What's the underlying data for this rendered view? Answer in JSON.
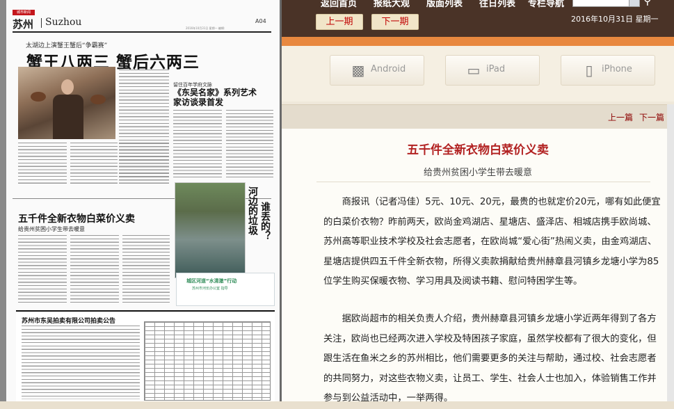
{
  "newspaper": {
    "section_logo": "城市新闻",
    "city": "苏州",
    "city_en": "Suzhou",
    "page": "A04",
    "date_line": "2016年10月31日 星期一 编辑:",
    "kicker": "太湖边上演蟹王蟹后“争霸赛”",
    "headline": "蟹王八两三  蟹后六两三",
    "series_kicker": "留住百年学府文脉",
    "series_headline": "《东吴名家》系列艺术家访谈录首发",
    "article2_headline": "五千件全新衣物白菜价义卖",
    "article2_sub": "给贵州贫困小学生带去暖意",
    "photo_title_1": "河边的垃圾",
    "photo_title_2": "谁丢的？",
    "caption_green": "城区河道“水清澈”行动",
    "caption_sub": "苏州市河长办公室 指导",
    "auction_title": "苏州市东吴拍卖有限公司拍卖公告"
  },
  "topbar": {
    "nav_items": [
      "返回首页",
      "报纸大观",
      "版面列表",
      "往日列表",
      "专栏导航"
    ],
    "prev_issue": "上一期",
    "next_issue": "下一期",
    "date": "2016年10月31日 星期一",
    "search_icon": "search-icon"
  },
  "devices": [
    {
      "label": "Android",
      "icon": "android-icon"
    },
    {
      "label": "iPad",
      "icon": "tablet-icon"
    },
    {
      "label": "iPhone",
      "icon": "phone-icon"
    }
  ],
  "article_nav": {
    "prev": "上一篇",
    "next": "下一篇"
  },
  "article": {
    "title": "五千件全新衣物白菜价义卖",
    "subtitle": "给贵州贫困小学生带去暖意",
    "paragraph1": "商报讯（记者冯佳）5元、10元、20元，最贵的也就定价20元，哪有如此便宜的白菜价衣物？昨前两天，欧尚金鸡湖店、星塘店、盛泽店、相城店携手欧尚城、苏州高等职业技术学校及社会志愿者，在欧尚城“爱心街”热闹义卖，由金鸡湖店、星塘店提供四五千件全新衣物，所得义卖款捐献给贵州赫章县河镇乡龙塘小学为85位学生购买保暖衣物、学习用具及阅读书籍、慰问特困学生等。",
    "paragraph2": "据欧尚超市的相关负责人介绍，贵州赫章县河镇乡龙塘小学近两年得到了各方关注，欧尚也已经两次进入学校及特困孩子家庭，虽然学校都有了很大的变化，但跟生活在鱼米之乡的苏州相比，他们需要更多的关注与帮助，通过校、社会志愿者的共同努力，对这些衣物义卖，让员工、学生、社会人士也加入，体验销售工作并参与到公益活动中，一举两得。"
  }
}
